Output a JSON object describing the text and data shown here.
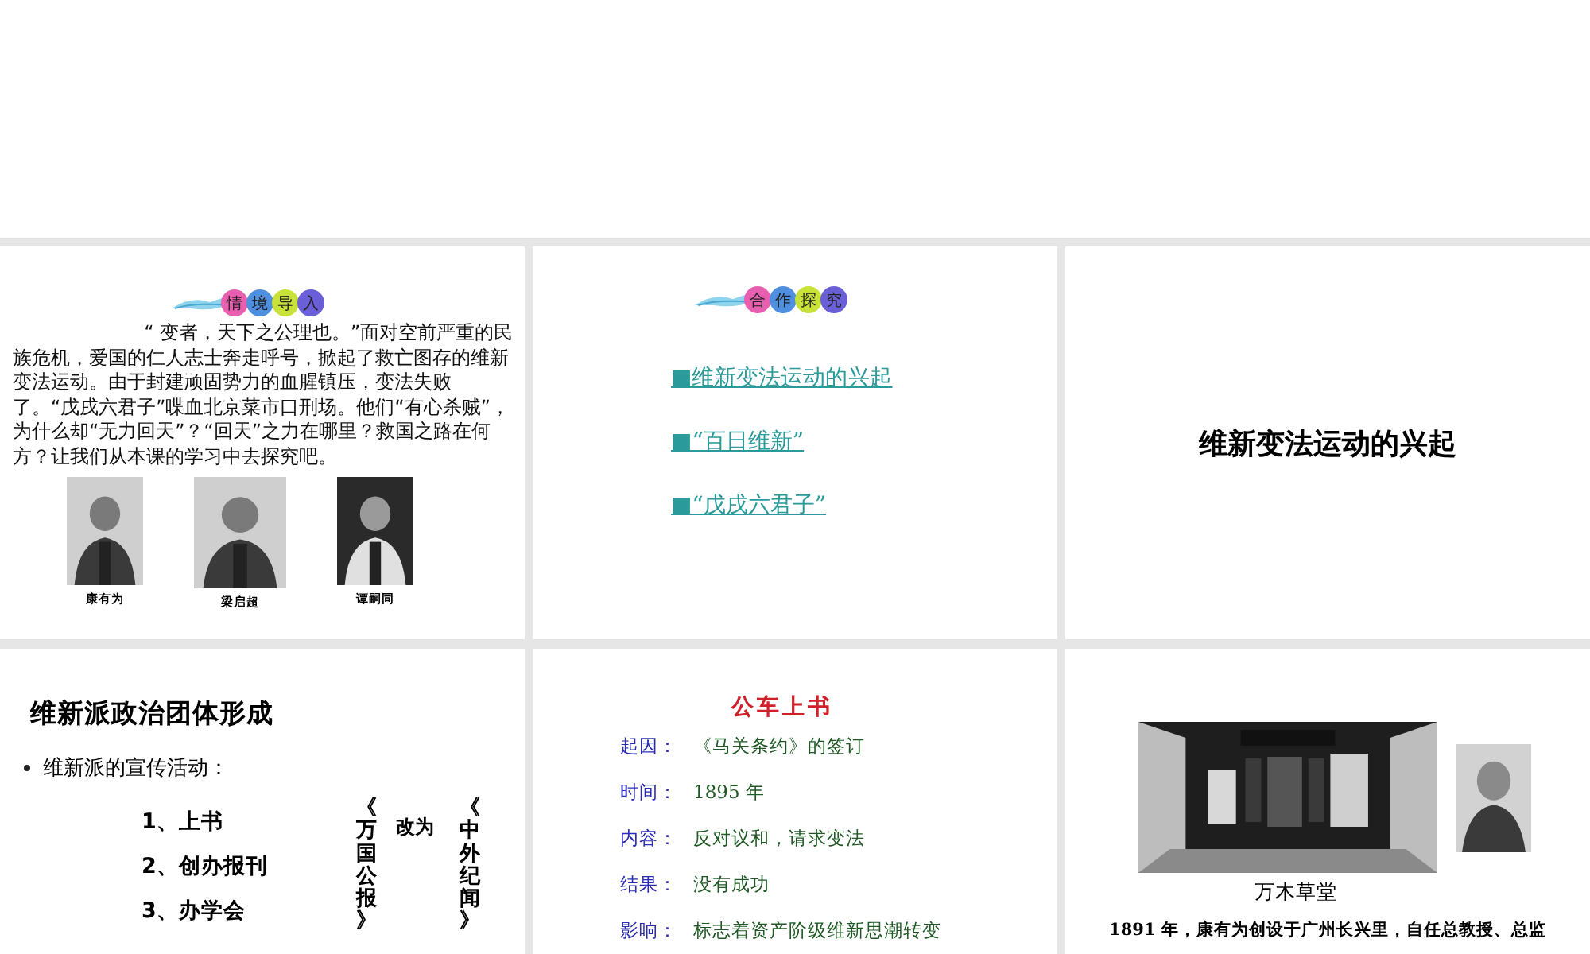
{
  "intro": {
    "badge": [
      {
        "char": "情",
        "color": "#e85fb0"
      },
      {
        "char": "境",
        "color": "#4f8fe0"
      },
      {
        "char": "导",
        "color": "#c8e23a"
      },
      {
        "char": "入",
        "color": "#6a5fd8"
      }
    ],
    "paragraph": "“ 变者，天下之公理也。”面对空前严重的民族危机，爱国的仁人志士奔走呼号，掀起了救亡图存的维新变法运动。由于封建顽固势力的血腥镇压，变法失败了。“戊戌六君子”喋血北京菜市口刑场。他们“有心杀贼”，为什么却“无力回天”？“回天”之力在哪里？救国之路在何方？让我们从本课的学习中去探究吧。",
    "portraits": [
      {
        "caption": "康有为"
      },
      {
        "caption": "梁启超"
      },
      {
        "caption": "谭嗣同"
      }
    ]
  },
  "explore": {
    "badge": [
      {
        "char": "合",
        "color": "#e85fb0"
      },
      {
        "char": "作",
        "color": "#4f8fe0"
      },
      {
        "char": "探",
        "color": "#c8e23a"
      },
      {
        "char": "究",
        "color": "#6a5fd8"
      }
    ],
    "links": [
      "■维新变法运动的兴起",
      "■“百日维新”",
      "■“戊戌六君子”"
    ]
  },
  "section": {
    "title": "维新变法运动的兴起"
  },
  "groups": {
    "title": "维新派政治团体形成",
    "bullet": "维新派的宣传活动：",
    "items": [
      "1、上书",
      "2、创办报刊",
      "3、办学会"
    ],
    "old_paper": "《万国公报》",
    "renamed": "改为",
    "new_paper": "《中外纪闻》"
  },
  "petition": {
    "title": "公车上书",
    "rows": [
      {
        "label": "起因：",
        "value": "《马关条约》的签订"
      },
      {
        "label": "时间：",
        "value": "1895 年"
      },
      {
        "label": "内容：",
        "value": "反对议和，请求变法"
      },
      {
        "label": "结果：",
        "value": "没有成功"
      },
      {
        "label": "影响：",
        "value": "标志着资产阶级维新思潮转变"
      }
    ]
  },
  "school": {
    "caption": "万木草堂",
    "text": "1891 年，康有为创设于广州长兴里，自任总教授、总监"
  }
}
